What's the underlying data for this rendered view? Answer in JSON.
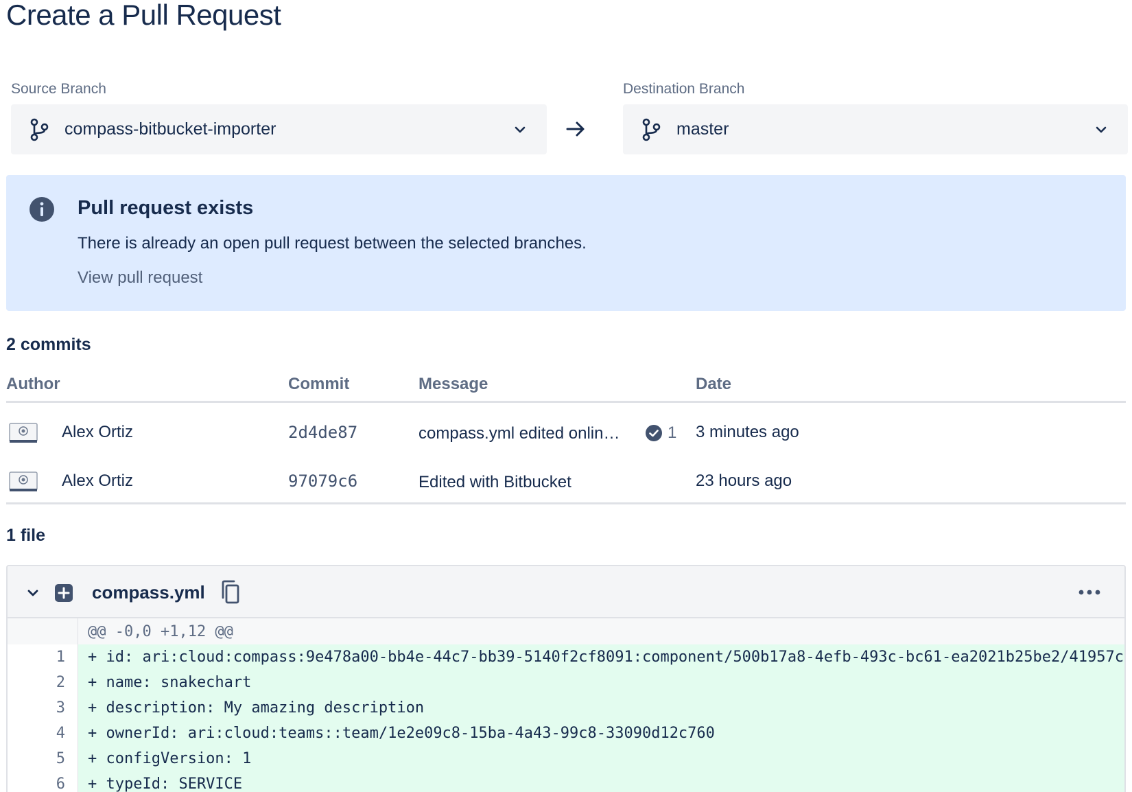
{
  "page": {
    "title": "Create a Pull Request"
  },
  "branches": {
    "source_label": "Source Branch",
    "source_value": "compass-bitbucket-importer",
    "destination_label": "Destination Branch",
    "destination_value": "master"
  },
  "banner": {
    "title": "Pull request exists",
    "text": "There is already an open pull request between the selected branches.",
    "link": "View pull request"
  },
  "commits": {
    "heading": "2 commits",
    "columns": {
      "author": "Author",
      "commit": "Commit",
      "message": "Message",
      "date": "Date"
    },
    "rows": [
      {
        "author": "Alex Ortiz",
        "hash": "2d4de87",
        "message": "compass.yml edited onlin…",
        "checks": "1",
        "date": "3 minutes ago"
      },
      {
        "author": "Alex Ortiz",
        "hash": "97079c6",
        "message": "Edited with Bitbucket",
        "checks": "",
        "date": "23 hours ago"
      }
    ]
  },
  "files": {
    "heading": "1 file",
    "file": {
      "name": "compass.yml",
      "hunk": "@@ -0,0 +1,12 @@",
      "lines": [
        {
          "no": "1",
          "text": "+ id: ari:cloud:compass:9e478a00-bb4e-44c7-bb39-5140f2cf8091:component/500b17a8-4efb-493c-bc61-ea2021b25be2/41957c"
        },
        {
          "no": "2",
          "text": "+ name: snakechart"
        },
        {
          "no": "3",
          "text": "+ description: My amazing description"
        },
        {
          "no": "4",
          "text": "+ ownerId: ari:cloud:teams::team/1e2e09c8-15ba-4a43-99c8-33090d12c760"
        },
        {
          "no": "5",
          "text": "+ configVersion: 1"
        },
        {
          "no": "6",
          "text": "+ typeId: SERVICE"
        }
      ]
    }
  },
  "icons": {
    "branch": "branch-icon",
    "chevron": "chevron-down-icon",
    "arrow": "arrow-right-icon",
    "info": "info-icon",
    "check": "check-circle-icon",
    "added": "file-added-icon",
    "copy": "copy-icon",
    "more": "more-icon"
  },
  "colors": {
    "text": "#172b4d",
    "muted": "#5e6c84",
    "banner_bg": "#deebff",
    "info_blue": "#42526e",
    "added_line_bg": "#e3fcef"
  }
}
